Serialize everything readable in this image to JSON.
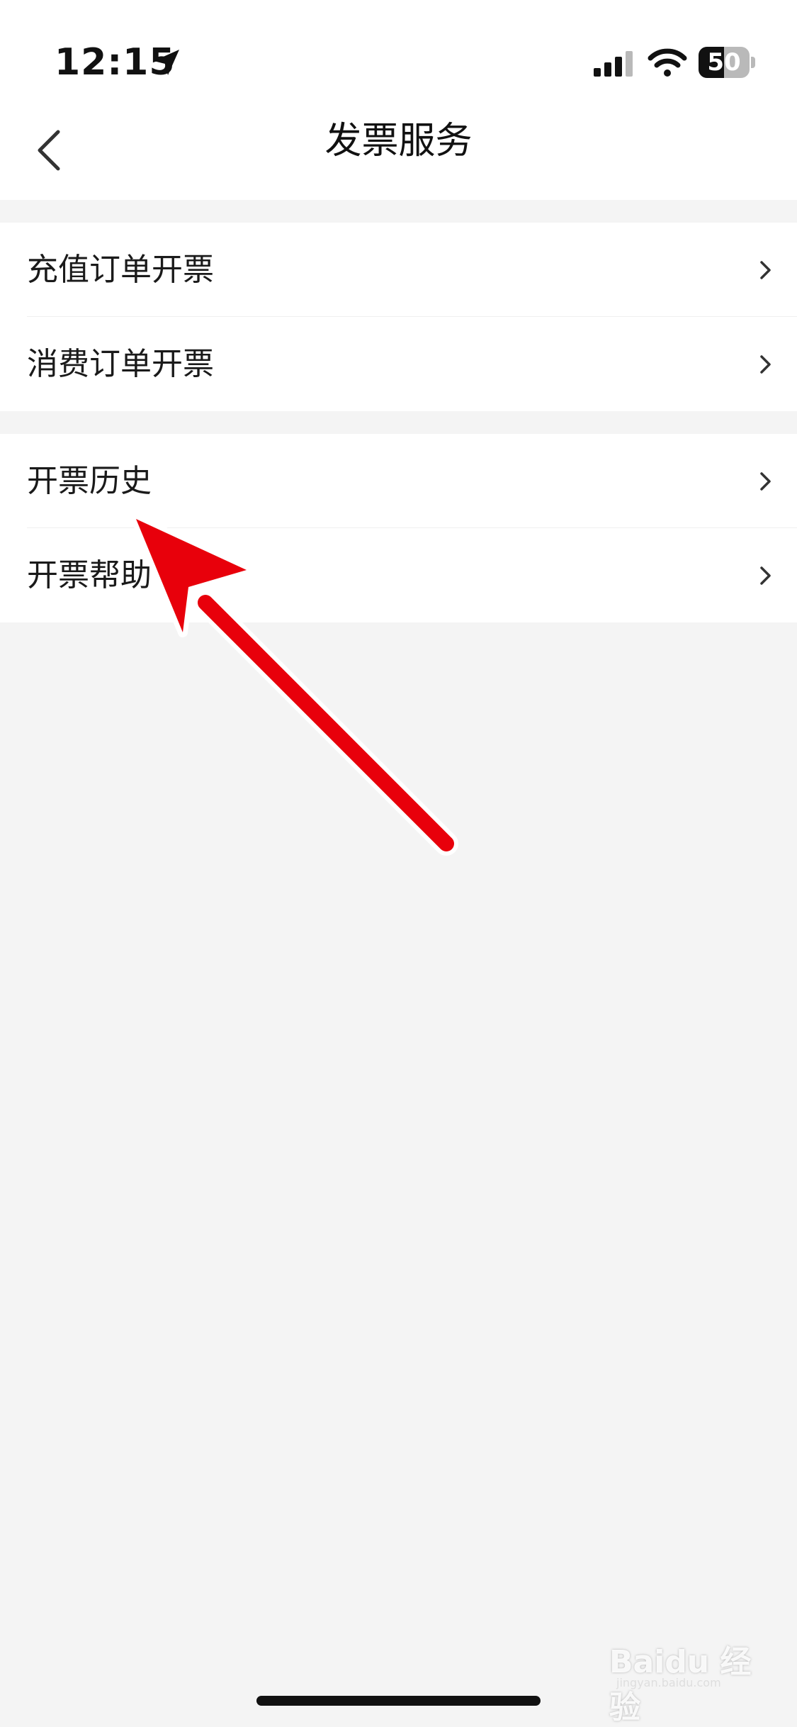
{
  "status_bar": {
    "time": "12:15",
    "battery_level": "50",
    "icons": [
      "location-arrow-icon",
      "cellular-signal-icon",
      "wifi-icon",
      "battery-icon"
    ]
  },
  "nav": {
    "title": "发票服务",
    "back_icon": "chevron-left-icon"
  },
  "groups": [
    {
      "items": [
        {
          "label": "充值订单开票",
          "icon": "chevron-right-icon"
        },
        {
          "label": "消费订单开票",
          "icon": "chevron-right-icon"
        }
      ]
    },
    {
      "items": [
        {
          "label": "开票历史",
          "icon": "chevron-right-icon"
        },
        {
          "label": "开票帮助",
          "icon": "chevron-right-icon"
        }
      ]
    }
  ],
  "annotation": {
    "type": "red-arrow",
    "color": "#e8000b",
    "points_to": "开票历史"
  },
  "watermark": {
    "logo_text": "Baidu 经验",
    "url_text": "jingyan.baidu.com"
  },
  "colors": {
    "page_background": "#f4f4f4",
    "card_background": "#ffffff",
    "text_primary": "#111111",
    "arrow_red": "#e8000b"
  }
}
